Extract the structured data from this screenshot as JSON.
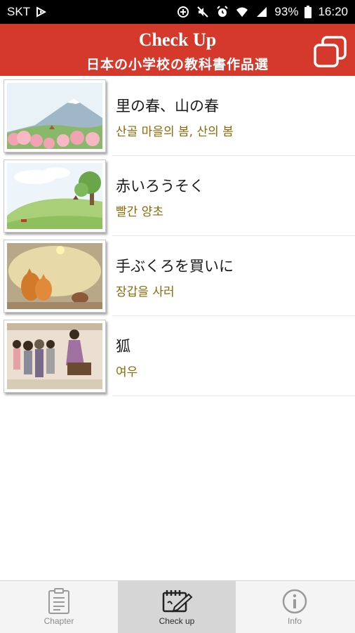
{
  "status_bar": {
    "carrier": "SKT",
    "battery": "93%",
    "time": "16:20",
    "icons": [
      "cast-icon",
      "data-saver-icon",
      "mute-icon",
      "alarm-icon",
      "wifi-icon",
      "signal-icon",
      "battery-icon"
    ]
  },
  "header": {
    "title": "Check Up",
    "subtitle": "日本の小学校の教科書作品選",
    "background": "#d4392c",
    "action_icon": "copy-icon"
  },
  "items": [
    {
      "title_ja": "里の春、山の春",
      "title_ko": "산골 마을의 봄, 산의 봄",
      "thumbnail": "spring-village-thumbnail"
    },
    {
      "title_ja": "赤いろうそく",
      "title_ko": "빨간 양초",
      "thumbnail": "red-candle-thumbnail"
    },
    {
      "title_ja": "手ぶくろを買いに",
      "title_ko": "장갑을 사러",
      "thumbnail": "buying-gloves-thumbnail"
    },
    {
      "title_ja": "狐",
      "title_ko": "여우",
      "thumbnail": "fox-thumbnail"
    }
  ],
  "bottom_nav": {
    "chapter": "Chapter",
    "checkup": "Check up",
    "info": "Info",
    "active": "checkup"
  },
  "colors": {
    "accent": "#d4392c",
    "subtitle_text": "#8a6a08"
  }
}
